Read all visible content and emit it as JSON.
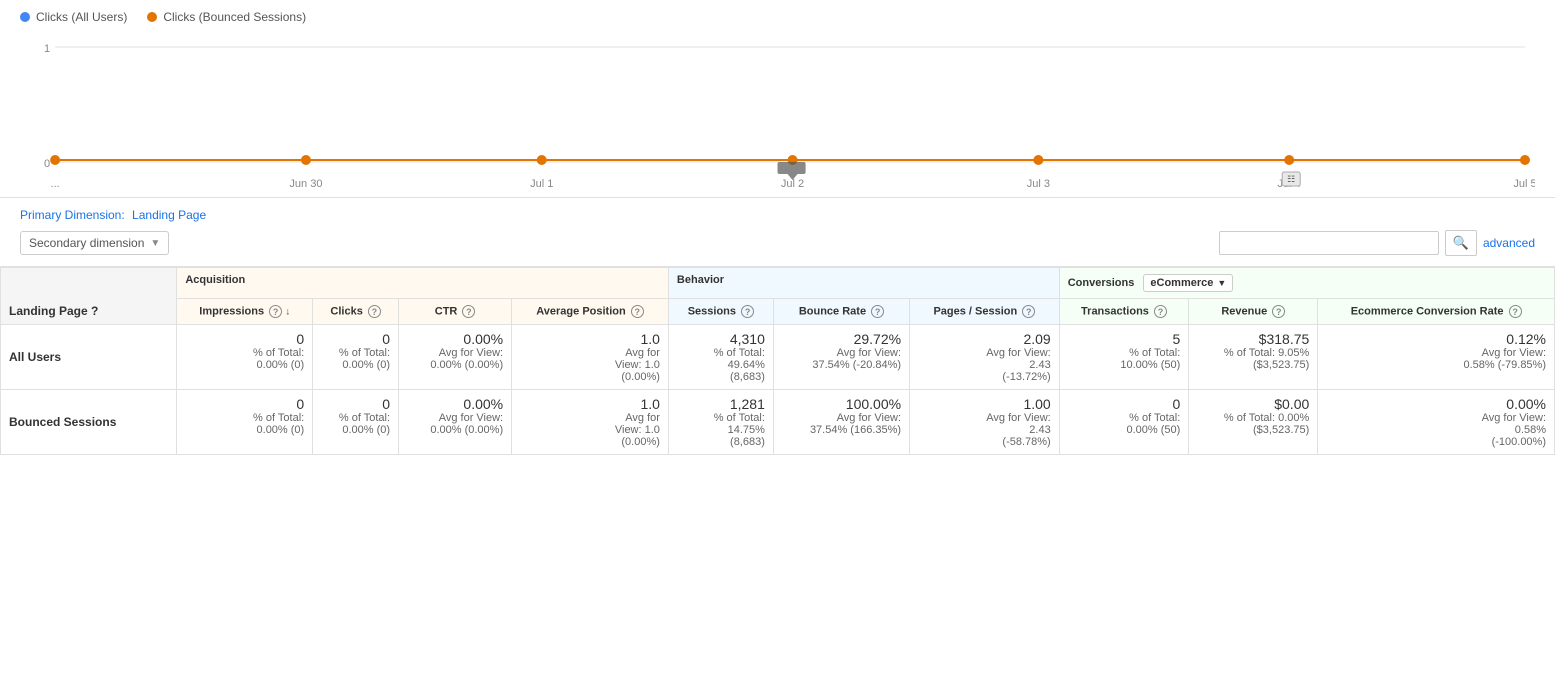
{
  "legend": {
    "item1_label": "Clicks (All Users)",
    "item1_color": "#4285F4",
    "item2_label": "Clicks (Bounced Sessions)",
    "item2_color": "#E37400"
  },
  "chart": {
    "y_label_1": "1",
    "y_label_0": "0",
    "x_labels": [
      "...",
      "Jun 30",
      "Jul 1",
      "Jul 2",
      "Jul 3",
      "Jul 4",
      "Jul 5"
    ]
  },
  "controls": {
    "primary_dim_label": "Primary Dimension:",
    "primary_dim_value": "Landing Page",
    "secondary_dim_label": "Secondary dimension",
    "search_placeholder": "",
    "advanced_label": "advanced"
  },
  "table": {
    "landing_page_col": "Landing Page",
    "help_icon": "?",
    "group_acquisition": "Acquisition",
    "group_behavior": "Behavior",
    "group_conversions": "Conversions",
    "ecommerce_label": "eCommerce",
    "columns": [
      {
        "id": "impressions",
        "label": "Impressions",
        "sort": true
      },
      {
        "id": "clicks",
        "label": "Clicks"
      },
      {
        "id": "ctr",
        "label": "CTR"
      },
      {
        "id": "avg_position",
        "label": "Average Position"
      },
      {
        "id": "sessions",
        "label": "Sessions"
      },
      {
        "id": "bounce_rate",
        "label": "Bounce Rate"
      },
      {
        "id": "pages_session",
        "label": "Pages / Session"
      },
      {
        "id": "transactions",
        "label": "Transactions"
      },
      {
        "id": "revenue",
        "label": "Revenue"
      },
      {
        "id": "ecom_conv_rate",
        "label": "Ecommerce Conversion Rate"
      }
    ],
    "rows": [
      {
        "label": "All Users",
        "impressions": "0",
        "impressions_sub": "% of Total:\n0.00% (0)",
        "clicks": "0",
        "clicks_sub": "% of Total:\n0.00% (0)",
        "ctr": "0.00%",
        "ctr_sub": "Avg for View:\n0.00% (0.00%)",
        "avg_position": "1.0",
        "avg_position_sub": "Avg for\nView: 1.0\n(0.00%)",
        "sessions": "4,310",
        "sessions_sub": "% of Total:\n49.64%\n(8,683)",
        "bounce_rate": "29.72%",
        "bounce_rate_sub": "Avg for View:\n37.54% (-20.84%)",
        "pages_session": "2.09",
        "pages_session_sub": "Avg for View:\n2.43\n(-13.72%)",
        "transactions": "5",
        "transactions_sub": "% of Total:\n10.00% (50)",
        "revenue": "$318.75",
        "revenue_sub": "% of Total: 9.05%\n($3,523.75)",
        "ecom_conv_rate": "0.12%",
        "ecom_conv_rate_sub": "Avg for View:\n0.58% (-79.85%)"
      },
      {
        "label": "Bounced Sessions",
        "impressions": "0",
        "impressions_sub": "% of Total:\n0.00% (0)",
        "clicks": "0",
        "clicks_sub": "% of Total:\n0.00% (0)",
        "ctr": "0.00%",
        "ctr_sub": "Avg for View:\n0.00% (0.00%)",
        "avg_position": "1.0",
        "avg_position_sub": "Avg for\nView: 1.0\n(0.00%)",
        "sessions": "1,281",
        "sessions_sub": "% of Total:\n14.75%\n(8,683)",
        "bounce_rate": "100.00%",
        "bounce_rate_sub": "Avg for View:\n37.54% (166.35%)",
        "pages_session": "1.00",
        "pages_session_sub": "Avg for View:\n2.43\n(-58.78%)",
        "transactions": "0",
        "transactions_sub": "% of Total:\n0.00% (50)",
        "revenue": "$0.00",
        "revenue_sub": "% of Total: 0.00%\n($3,523.75)",
        "ecom_conv_rate": "0.00%",
        "ecom_conv_rate_sub": "Avg for View:\n0.58%\n(-100.00%)"
      }
    ]
  }
}
